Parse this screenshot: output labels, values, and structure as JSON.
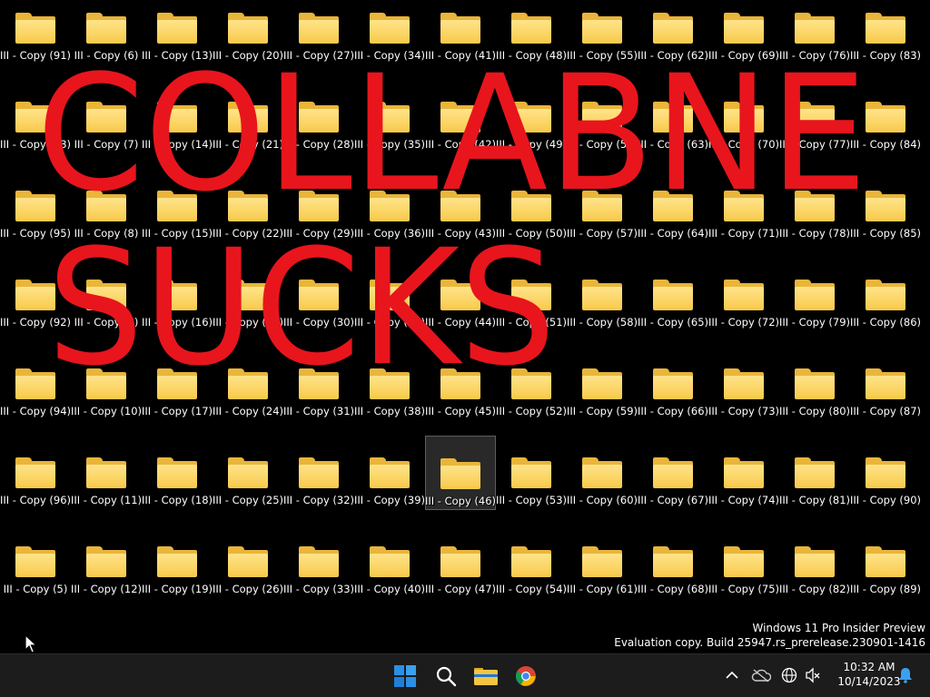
{
  "desktop": {
    "columns": [
      [
        "III - Copy (91)",
        "III - Copy (93)",
        "III - Copy (95)",
        "III - Copy (92)",
        "III - Copy (94)",
        "III - Copy (96)",
        "III - Copy (5)"
      ],
      [
        "III - Copy (6)",
        "III - Copy (7)",
        "III - Copy (8)",
        "III - Copy (9)",
        "III - Copy (10)",
        "III - Copy (11)",
        "III - Copy (12)"
      ],
      [
        "III - Copy (13)",
        "III - Copy (14)",
        "III - Copy (15)",
        "III - Copy (16)",
        "III - Copy (17)",
        "III - Copy (18)",
        "III - Copy (19)"
      ],
      [
        "III - Copy (20)",
        "III - Copy (21)",
        "III - Copy (22)",
        "III - Copy (23)",
        "III - Copy (24)",
        "III - Copy (25)",
        "III - Copy (26)"
      ],
      [
        "III - Copy (27)",
        "III - Copy (28)",
        "III - Copy (29)",
        "III - Copy (30)",
        "III - Copy (31)",
        "III - Copy (32)",
        "III - Copy (33)"
      ],
      [
        "III - Copy (34)",
        "III - Copy (35)",
        "III - Copy (36)",
        "III - Copy (37)",
        "III - Copy (38)",
        "III - Copy (39)",
        "III - Copy (40)"
      ],
      [
        "III - Copy (41)",
        "III - Copy (42)",
        "III - Copy (43)",
        "III - Copy (44)",
        "III - Copy (45)",
        "III - Copy (46)",
        "III - Copy (47)"
      ],
      [
        "III - Copy (48)",
        "III - Copy (49)",
        "III - Copy (50)",
        "III - Copy (51)",
        "III - Copy (52)",
        "III - Copy (53)",
        "III - Copy (54)"
      ],
      [
        "III - Copy (55)",
        "III - Copy (56)",
        "III - Copy (57)",
        "III - Copy (58)",
        "III - Copy (59)",
        "III - Copy (60)",
        "III - Copy (61)"
      ],
      [
        "III - Copy (62)",
        "III - Copy (63)",
        "III - Copy (64)",
        "III - Copy (65)",
        "III - Copy (66)",
        "III - Copy (67)",
        "III - Copy (68)"
      ],
      [
        "III - Copy (69)",
        "III - Copy (70)",
        "III - Copy (71)",
        "III - Copy (72)",
        "III - Copy (73)",
        "III - Copy (74)",
        "III - Copy (75)"
      ],
      [
        "III - Copy (76)",
        "III - Copy (77)",
        "III - Copy (78)",
        "III - Copy (79)",
        "III - Copy (80)",
        "III - Copy (81)",
        "III - Copy (82)"
      ],
      [
        "III - Copy (83)",
        "III - Copy (84)",
        "III - Copy (85)",
        "III - Copy (86)",
        "III - Copy (87)",
        "III - Copy (90)",
        "III - Copy (89)"
      ]
    ],
    "selected": "III - Copy (46)",
    "folder_color": "#f8c94a"
  },
  "graffiti": {
    "line1": "COLLABNE",
    "line2": "SUCKS",
    "color": "#e8151d"
  },
  "watermark": {
    "line1": "Windows 11 Pro Insider Preview",
    "line2": "Evaluation copy. Build 25947.rs_prerelease.230901-1416"
  },
  "taskbar": {
    "apps": [
      "start-icon",
      "search-icon",
      "file-explorer-icon",
      "chrome-icon"
    ],
    "tray": [
      "chevron-up-icon",
      "onedrive-offline-icon",
      "network-globe-icon",
      "volume-muted-icon",
      "notification-bell-icon"
    ],
    "time": "10:32 AM",
    "date": "10/14/2023"
  }
}
